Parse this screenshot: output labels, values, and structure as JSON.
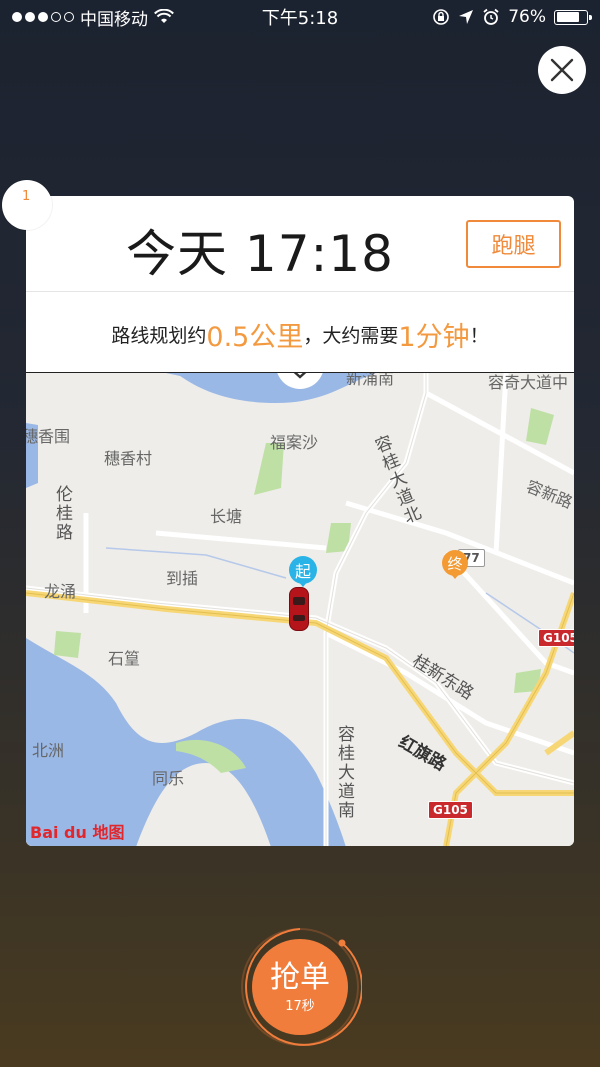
{
  "status_bar": {
    "carrier": "中国移动",
    "time": "下午5:18",
    "battery": "76%",
    "battery_level": 0.76,
    "signal_filled": 3,
    "signal_total": 5
  },
  "order": {
    "index": "1",
    "time": "今天 17:18",
    "type_label": "跑腿",
    "route": {
      "prefix": "路线规划约",
      "distance": "0.5公里",
      "middle": "，大约需要",
      "duration": "1分钟",
      "suffix": "！"
    }
  },
  "map": {
    "start_label": "起",
    "end_label": "终",
    "places": {
      "suixiangwei": "穗香围",
      "suixiangcun": "穗香村",
      "fuansha": "福案沙",
      "changtang": "长塘",
      "dacha": "到插",
      "longyong": "龙涌",
      "shihuang": "石篁",
      "beizhou": "北洲",
      "tongle": "同乐",
      "xinyongnan": "新涌南",
      "rongqi": "容奇大道中",
      "rongxin": "容新路"
    },
    "roads": {
      "lunguilu": "伦桂路",
      "ronggui_north": "容桂大道北",
      "ronggui_south": "容桂大道南",
      "guixindong": "桂新东路",
      "hongqilu": "红旗路",
      "g105_a": "G105",
      "g105_b": "G105",
      "shield_77": "77"
    },
    "provider": "Bai du 地图",
    "colors": {
      "water": "#9ab8e6",
      "green": "#bfe0a4",
      "highway": "#f7d775",
      "land": "#eeede9"
    }
  },
  "grab": {
    "label": "抢单",
    "countdown": "17秒"
  },
  "colors": {
    "accent": "#f08a3a",
    "highlight": "#f39a40",
    "start_pin": "#2ab3e6",
    "end_pin": "#f39a33"
  }
}
